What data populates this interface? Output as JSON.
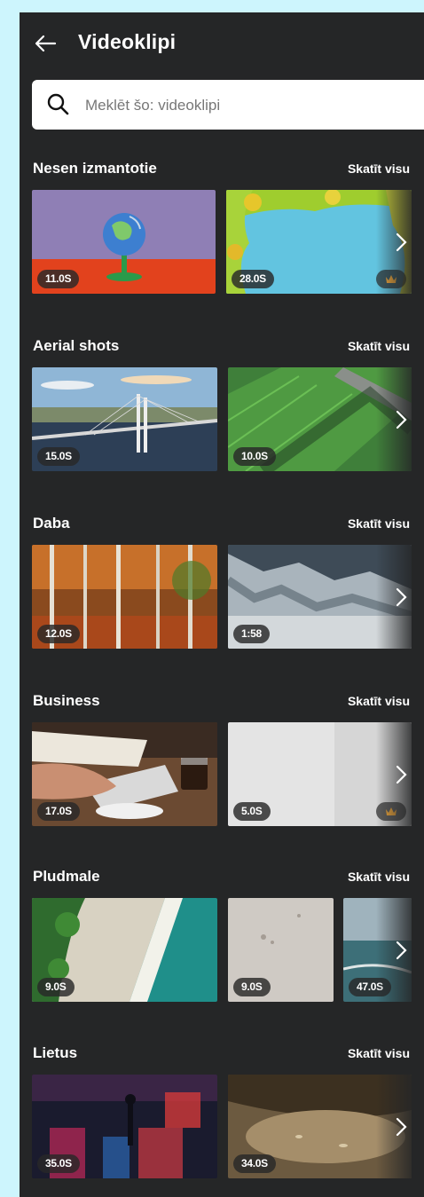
{
  "header": {
    "title": "Videoklipi",
    "back_icon": "arrow-left-icon"
  },
  "search": {
    "placeholder": "Meklēt šo: videoklipi",
    "value": "",
    "icon": "search-icon"
  },
  "sections": [
    {
      "title": "Nesen izmantotie",
      "link": "Skatīt visu",
      "items": [
        {
          "duration": "11.0S",
          "premium": false,
          "scene": "globe"
        },
        {
          "duration": "28.0S",
          "premium": true,
          "scene": "leaves"
        }
      ]
    },
    {
      "title": "Aerial shots",
      "link": "Skatīt visu",
      "items": [
        {
          "duration": "15.0S",
          "premium": false,
          "scene": "bridge"
        },
        {
          "duration": "10.0S",
          "premium": false,
          "scene": "field"
        }
      ]
    },
    {
      "title": "Daba",
      "link": "Skatīt visu",
      "items": [
        {
          "duration": "12.0S",
          "premium": false,
          "scene": "forest"
        },
        {
          "duration": "1:58",
          "premium": false,
          "scene": "fog"
        }
      ]
    },
    {
      "title": "Business",
      "link": "Skatīt visu",
      "items": [
        {
          "duration": "17.0S",
          "premium": false,
          "scene": "typing"
        },
        {
          "duration": "5.0S",
          "premium": true,
          "scene": "white"
        }
      ]
    },
    {
      "title": "Pludmale",
      "link": "Skatīt visu",
      "items": [
        {
          "duration": "9.0S",
          "premium": false,
          "scene": "beach"
        },
        {
          "duration": "9.0S",
          "premium": false,
          "scene": "sand"
        },
        {
          "duration": "47.0S",
          "premium": false,
          "scene": "sea"
        }
      ]
    },
    {
      "title": "Lietus",
      "link": "Skatīt visu",
      "items": [
        {
          "duration": "35.0S",
          "premium": false,
          "scene": "night-rain"
        },
        {
          "duration": "34.0S",
          "premium": false,
          "scene": "puddle"
        }
      ]
    }
  ],
  "colors": {
    "page_background": "#cdf5fd",
    "panel_background": "#252627",
    "text": "#ffffff",
    "crown": "#f3a93b"
  }
}
